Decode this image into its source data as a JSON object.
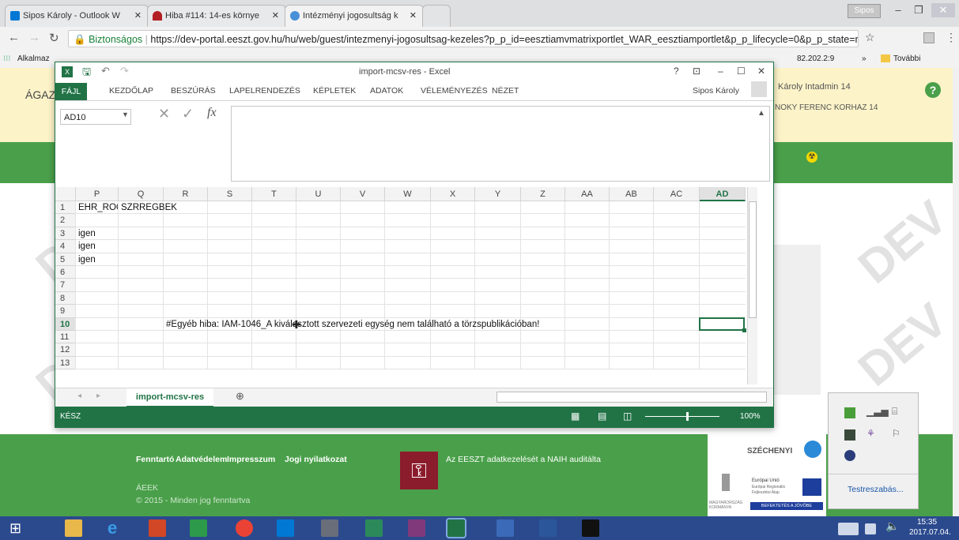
{
  "browser": {
    "tabs": [
      {
        "label": "Sipos Károly - Outlook W",
        "icon": "outlook-icon",
        "color": "#0078d4"
      },
      {
        "label": "Hiba #114: 14-es környe",
        "icon": "redmine-icon",
        "color": "#b32024"
      },
      {
        "label": "Intézményi jogosultság k",
        "icon": "liferay-icon",
        "color": "#4a90d9"
      }
    ],
    "profile": "Sipos",
    "secure_label": "Biztonságos",
    "url": "https://dev-portal.eeszt.gov.hu/hu/web/guest/intezmenyi-jogosultsag-kezeles?p_p_id=eesztiamvmatrixportlet_WAR_eesztiamportlet&p_p_lifecycle=0&p_p_state=normal&p",
    "bookmarks_left": "Alkalmaz",
    "bookmarks_right_ip": "82.202.2:9",
    "more_bookmarks": "További könyvjelzők"
  },
  "portal": {
    "title_fragment": "ÁGAZ",
    "user": "Károly Intadmin 14",
    "institution": "NOKY FERENC KORHAZ 14",
    "footer_links": [
      "Fenntartó",
      "Adatvédelem",
      "Impresszum",
      "Jogi nyilatkozat"
    ],
    "naih_text": "Az EESZT adatkezelését a NAIH auditálta",
    "org": "ÁEEK",
    "copyright": "© 2015 - Minden jog fenntartva",
    "szechenyi": "SZÉCHENYI",
    "eu_text": "Európai Unió",
    "eu_sub1": "Európai Regionális",
    "eu_sub2": "Fejlesztési Alap",
    "invest": "BEFEKTETÉS A JÖVŐBE",
    "gov": "MAGYARORSZÁG KORMÁNYA",
    "watermark": "DEV"
  },
  "excel": {
    "title": "import-mcsv-res - Excel",
    "user": "Sipos Károly",
    "ribbon_tabs": [
      "FÁJL",
      "KEZDŐLAP",
      "BESZÚRÁS",
      "LAPELRENDEZÉS",
      "KÉPLETEK",
      "ADATOK",
      "VÉLEMÉNYEZÉS",
      "NÉZET"
    ],
    "name_box": "AD10",
    "fx": "fx",
    "columns": [
      "P",
      "Q",
      "R",
      "S",
      "T",
      "U",
      "V",
      "W",
      "X",
      "Y",
      "Z",
      "AA",
      "AB",
      "AC",
      "AD"
    ],
    "rows": [
      "1",
      "2",
      "3",
      "4",
      "5",
      "6",
      "7",
      "8",
      "9",
      "10",
      "11",
      "12",
      "13"
    ],
    "cells": {
      "p1": "EHR_ROGZ",
      "q1": "SZRREGBEK",
      "p3": "igen",
      "p4": "igen",
      "p5": "igen",
      "r10": "#Egyéb hiba: IAM-1046_A kiválasztott szervezeti egység nem található a törzspublikációban!"
    },
    "sheet_tab": "import-mcsv-res",
    "status": "KÉSZ",
    "zoom": "100%"
  },
  "tray": {
    "customize": "Testreszabás..."
  },
  "taskbar": {
    "time": "15:35",
    "date": "2017.07.04."
  }
}
